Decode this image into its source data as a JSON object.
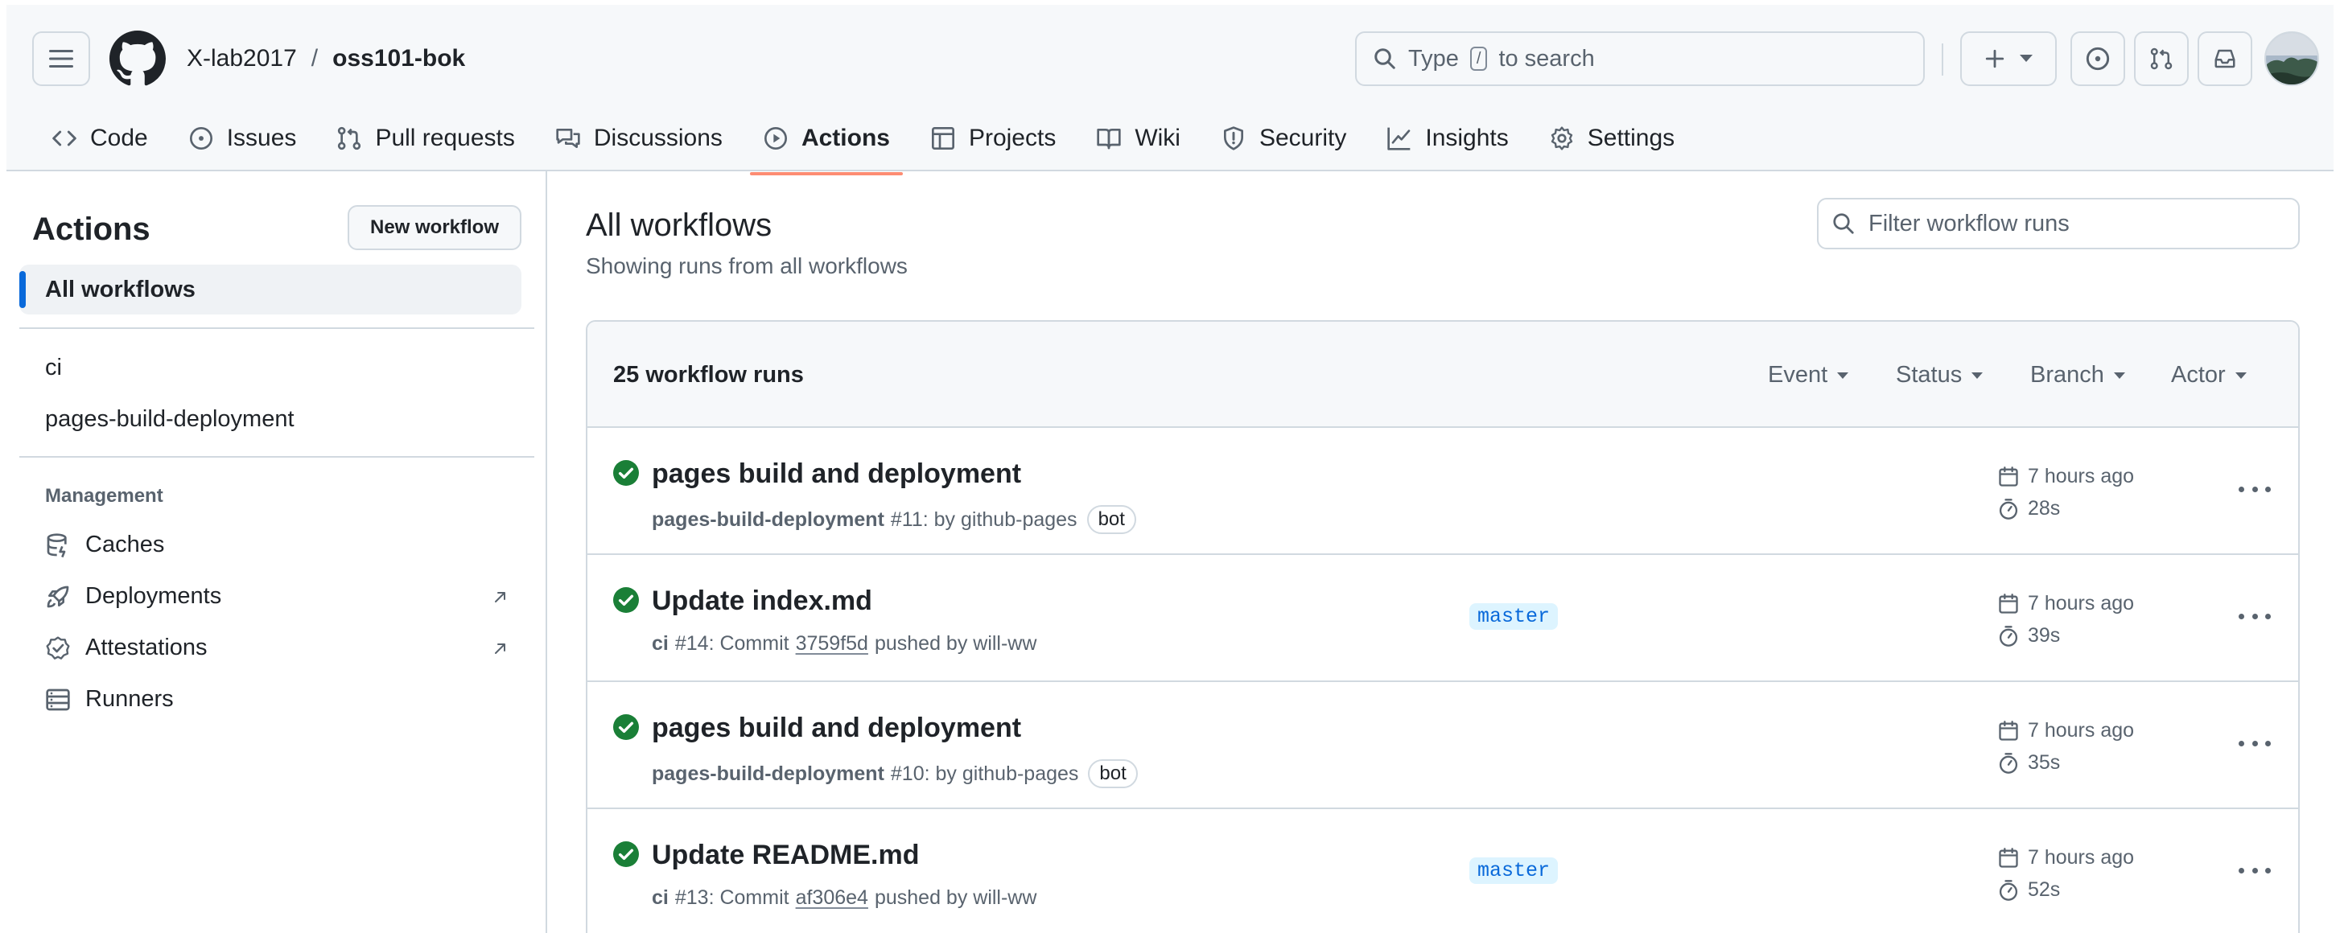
{
  "header": {
    "owner": "X-lab2017",
    "separator": "/",
    "repo": "oss101-bok",
    "search_prefix": "Type",
    "search_key": "/",
    "search_suffix": "to search"
  },
  "tabs": [
    {
      "label": "Code",
      "icon": "code-icon"
    },
    {
      "label": "Issues",
      "icon": "issue-opened-icon"
    },
    {
      "label": "Pull requests",
      "icon": "git-pull-request-icon"
    },
    {
      "label": "Discussions",
      "icon": "comment-discussion-icon"
    },
    {
      "label": "Actions",
      "icon": "play-icon",
      "active": true
    },
    {
      "label": "Projects",
      "icon": "table-icon"
    },
    {
      "label": "Wiki",
      "icon": "book-icon"
    },
    {
      "label": "Security",
      "icon": "shield-icon"
    },
    {
      "label": "Insights",
      "icon": "graph-icon"
    },
    {
      "label": "Settings",
      "icon": "gear-icon"
    }
  ],
  "sidebar": {
    "title": "Actions",
    "new_workflow": "New workflow",
    "all_workflows": "All workflows",
    "workflows": [
      "ci",
      "pages-build-deployment"
    ],
    "management_heading": "Management",
    "management": [
      {
        "label": "Caches",
        "icon": "database-icon"
      },
      {
        "label": "Deployments",
        "icon": "rocket-icon"
      },
      {
        "label": "Attestations",
        "icon": "verified-icon"
      },
      {
        "label": "Runners",
        "icon": "server-icon"
      }
    ]
  },
  "main": {
    "title": "All workflows",
    "subtitle": "Showing runs from all workflows",
    "filter_placeholder": "Filter workflow runs",
    "count_label": "25 workflow runs",
    "filters": [
      "Event",
      "Status",
      "Branch",
      "Actor"
    ]
  },
  "runs": [
    {
      "title": "pages build and deployment",
      "workflow": "pages-build-deployment",
      "text1": "#11: by github-pages",
      "bot": "bot",
      "branch": "",
      "time": "7 hours ago",
      "duration": "28s"
    },
    {
      "title": "Update index.md",
      "workflow": "ci",
      "text1": "#14: Commit",
      "sha": "3759f5d",
      "text2": "pushed by will-ww",
      "branch": "master",
      "time": "7 hours ago",
      "duration": "39s"
    },
    {
      "title": "pages build and deployment",
      "workflow": "pages-build-deployment",
      "text1": "#10: by github-pages",
      "bot": "bot",
      "branch": "",
      "time": "7 hours ago",
      "duration": "35s"
    },
    {
      "title": "Update README.md",
      "workflow": "ci",
      "text1": "#13: Commit",
      "sha": "af306e4",
      "text2": "pushed by will-ww",
      "branch": "master",
      "time": "7 hours ago",
      "duration": "52s"
    }
  ],
  "colors": {
    "accent": "#0969da",
    "success": "#1a7f37",
    "tab_underline": "#fd8c73"
  }
}
